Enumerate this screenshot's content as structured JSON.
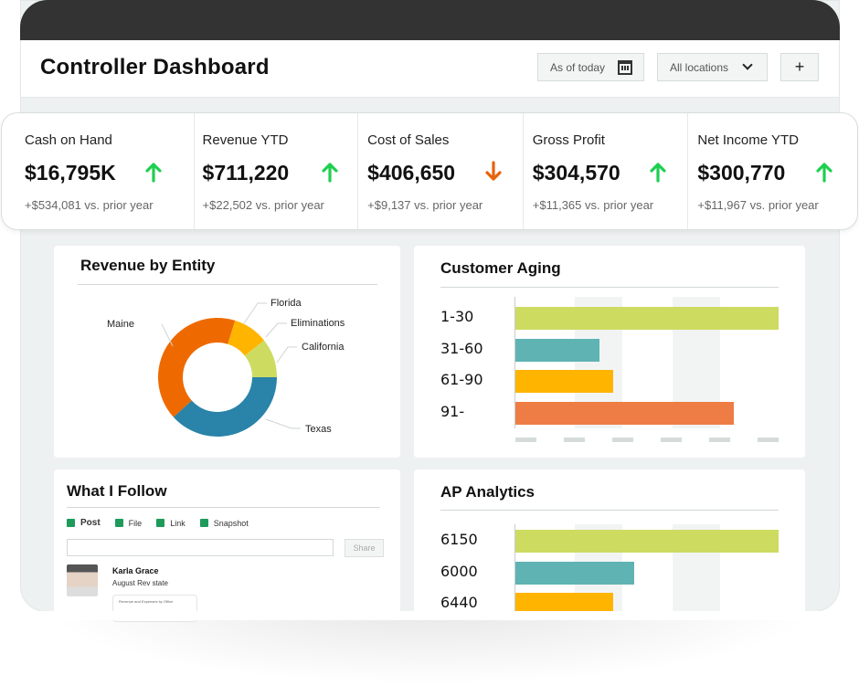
{
  "header": {
    "title": "Controller Dashboard",
    "date_filter": "As of today",
    "location_filter": "All locations",
    "add_label": "+"
  },
  "kpis": [
    {
      "label": "Cash on Hand",
      "value": "$16,795K",
      "trend": "up",
      "delta": "+$534,081 vs. prior year"
    },
    {
      "label": "Revenue YTD",
      "value": "$711,220",
      "trend": "up",
      "delta": "+$22,502 vs. prior year"
    },
    {
      "label": "Cost of Sales",
      "value": "$406,650",
      "trend": "down",
      "delta": "+$9,137 vs. prior year"
    },
    {
      "label": "Gross Profit",
      "value": "$304,570",
      "trend": "up",
      "delta": "+$11,365 vs. prior year"
    },
    {
      "label": "Net Income YTD",
      "value": "$300,770",
      "trend": "up",
      "delta": "+$11,967 vs. prior year"
    }
  ],
  "colors": {
    "up": "#1ecf4f",
    "down": "#e8620a",
    "lime": "#cddb61",
    "teal": "#5fb3b3",
    "amber": "#ffb400",
    "coral": "#ee7d45",
    "orange": "#ee6a00",
    "blue": "#2a83a8"
  },
  "chart_data": [
    {
      "type": "pie",
      "title": "Revenue by Entity",
      "donut": true,
      "slices": [
        {
          "label": "Texas",
          "value": 36,
          "color": "#2a83a8"
        },
        {
          "label": "Maine",
          "value": 39,
          "color": "#ee6a00"
        },
        {
          "label": "Florida",
          "value": 9,
          "color": "#ffb400"
        },
        {
          "label": "Eliminations",
          "value": 0,
          "color": "#cfd8d8"
        },
        {
          "label": "California",
          "value": 10,
          "color": "#cddb61"
        }
      ]
    },
    {
      "type": "bar",
      "orientation": "horizontal",
      "title": "Customer Aging",
      "categories": [
        "1-30",
        "31-60",
        "61-90",
        "91-"
      ],
      "values": [
        100,
        32,
        37,
        83
      ],
      "colors": [
        "#cddb61",
        "#5fb3b3",
        "#ffb400",
        "#ee7d45"
      ],
      "xlim": [
        0,
        100
      ],
      "tick_count": 6
    },
    {
      "type": "bar",
      "orientation": "horizontal",
      "title": "AP Analytics",
      "categories": [
        "6150",
        "6000",
        "6440"
      ],
      "values": [
        100,
        45,
        37
      ],
      "colors": [
        "#cddb61",
        "#5fb3b3",
        "#ffb400"
      ],
      "xlim": [
        0,
        100
      ]
    }
  ],
  "follow": {
    "title": "What I Follow",
    "tabs": [
      "Post",
      "File",
      "Link",
      "Snapshot"
    ],
    "share_label": "Share",
    "post_author": "Karla Grace",
    "post_text": "August Rev state",
    "attachment_title": "Revenue and Expenses by Office"
  }
}
